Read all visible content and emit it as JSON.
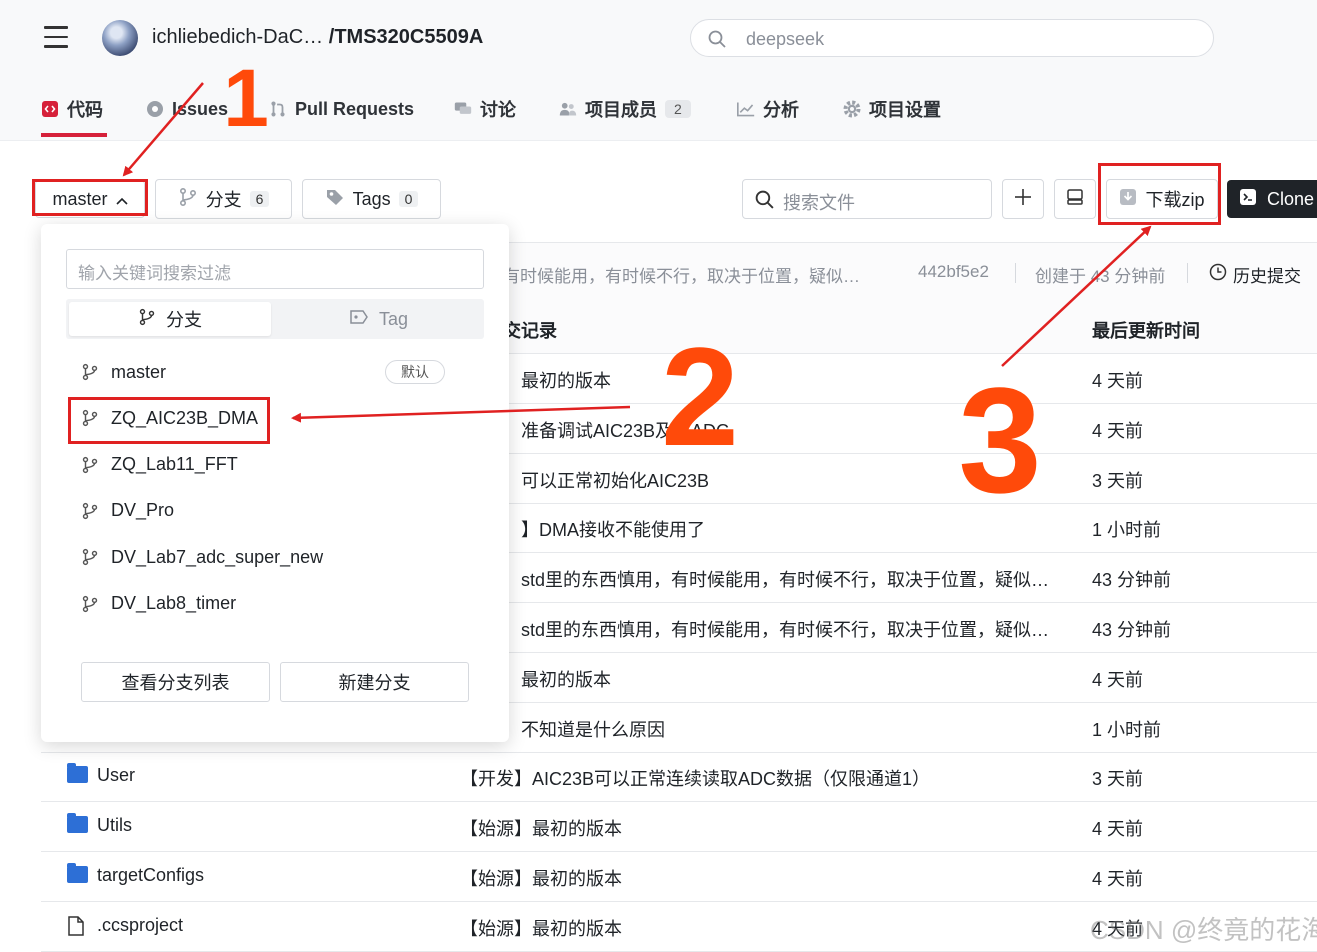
{
  "header": {
    "owner": "ichliebedich-DaC…",
    "separator": " /",
    "repo": "TMS320C5509A",
    "search_value": "deepseek"
  },
  "tabs": [
    {
      "label": "代码",
      "icon": "code-icon"
    },
    {
      "label": "Issues",
      "icon": "issue-icon"
    },
    {
      "label": "Pull Requests",
      "icon": "pull-request-icon"
    },
    {
      "label": "讨论",
      "icon": "discussion-icon"
    },
    {
      "label": "项目成员",
      "icon": "members-icon",
      "badge": "2"
    },
    {
      "label": "分析",
      "icon": "chart-icon"
    },
    {
      "label": "项目设置",
      "icon": "gear-icon"
    }
  ],
  "toolbar": {
    "branch_label": "master",
    "branches_label": "分支",
    "branches_count": "6",
    "tags_label": "Tags",
    "tags_count": "0",
    "file_search_placeholder": "搜索文件",
    "download_zip": "下载zip",
    "clone": "Clone"
  },
  "commit_bar": {
    "message": "有时候能用，有时候不行，取决于位置，疑似…",
    "hash": "442bf5e2",
    "created": "创建于 43 分钟前",
    "history": "历史提交"
  },
  "table": {
    "header_commit": "交记录",
    "header_time": "最后更新时间",
    "rows": [
      {
        "name": "",
        "commit": "最初的版本",
        "time": "4 天前"
      },
      {
        "name": "",
        "commit": "准备调试AIC23B及其ADC",
        "time": "4 天前"
      },
      {
        "name": "",
        "commit": "可以正常初始化AIC23B",
        "time": "3 天前"
      },
      {
        "name": "",
        "commit": "】DMA接收不能使用了",
        "time": "1 小时前"
      },
      {
        "name": "",
        "commit": "std里的东西慎用，有时候能用，有时候不行，取决于位置，疑似…",
        "time": "43 分钟前"
      },
      {
        "name": "",
        "commit": "std里的东西慎用，有时候能用，有时候不行，取决于位置，疑似…",
        "time": "43 分钟前"
      },
      {
        "name": "",
        "commit": "最初的版本",
        "time": "4 天前"
      },
      {
        "name": "",
        "commit": "不知道是什么原因",
        "time": "1 小时前"
      },
      {
        "name": "User",
        "commit": "【开发】AIC23B可以正常连续读取ADC数据（仅限通道1）",
        "time": "3 天前"
      },
      {
        "name": "Utils",
        "commit": "【始源】最初的版本",
        "time": "4 天前"
      },
      {
        "name": "targetConfigs",
        "commit": "【始源】最初的版本",
        "time": "4 天前"
      },
      {
        "name": ".ccsproject",
        "commit": "【始源】最初的版本",
        "time": "4 天前"
      }
    ]
  },
  "dropdown": {
    "filter_placeholder": "输入关键词搜索过滤",
    "seg_branch": "分支",
    "seg_tag": "Tag",
    "branches": [
      "master",
      "ZQ_AIC23B_DMA",
      "ZQ_Lab11_FFT",
      "DV_Pro",
      "DV_Lab7_adc_super_new",
      "DV_Lab8_timer"
    ],
    "default_badge": "默认",
    "view_list": "查看分支列表",
    "new_branch": "新建分支"
  },
  "annotations": {
    "step1": "1",
    "step2": "2",
    "step3": "3",
    "color": "#e02121",
    "orange": "#ff4a0a"
  },
  "watermark": "CSDN @终竟的花海"
}
